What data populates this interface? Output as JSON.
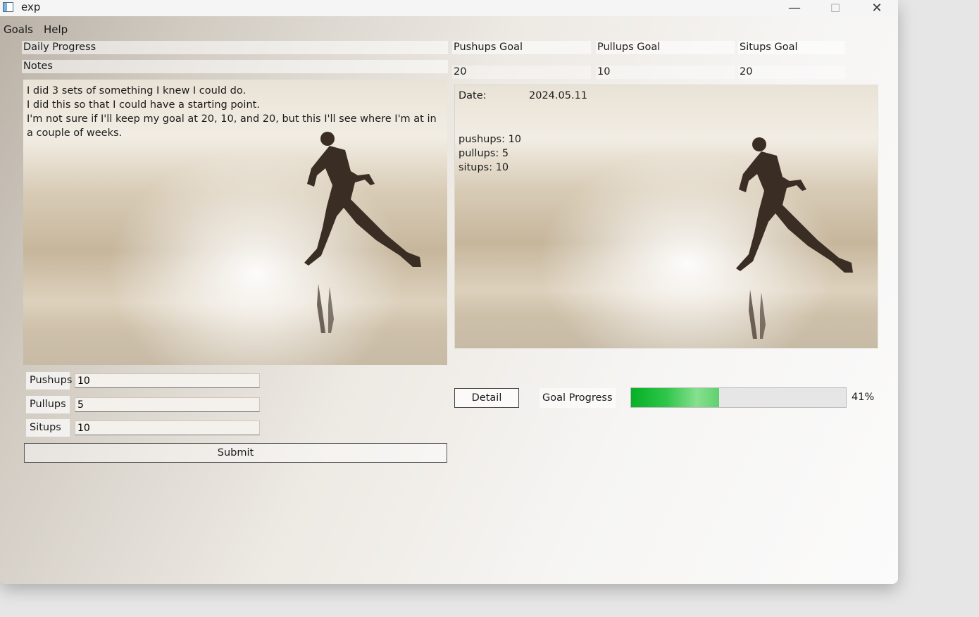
{
  "window": {
    "title": "exp",
    "controls": {
      "minimize": "—",
      "maximize": "☐",
      "close": "✕"
    }
  },
  "menu": [
    "Goals",
    "Help"
  ],
  "left": {
    "daily_progress_label": "Daily Progress",
    "notes_label": "Notes",
    "notes_text": "I did 3 sets of something I knew I could do.\nI did this so that I could have a starting point.\nI'm not sure if I'll keep my goal at 20, 10, and 20, but this I'll see where I'm at in a couple of weeks.",
    "form": [
      {
        "label": "Pushups",
        "value": "10"
      },
      {
        "label": "Pullups",
        "value": "5"
      },
      {
        "label": "Situps",
        "value": "10"
      }
    ],
    "submit_label": "Submit"
  },
  "goals": {
    "headers": [
      "Pushups Goal",
      "Pullups Goal",
      "Situps Goal"
    ],
    "values": [
      "20",
      "10",
      "20"
    ]
  },
  "detail": {
    "date_label": "Date:",
    "date_value": "2024.05.11",
    "lines": [
      "pushups: 10",
      "pullups: 5",
      "situps: 10"
    ]
  },
  "progress": {
    "detail_button": "Detail",
    "label": "Goal Progress",
    "percent_text": "41%",
    "fraction": 0.41,
    "fill_color": "#06b025"
  }
}
